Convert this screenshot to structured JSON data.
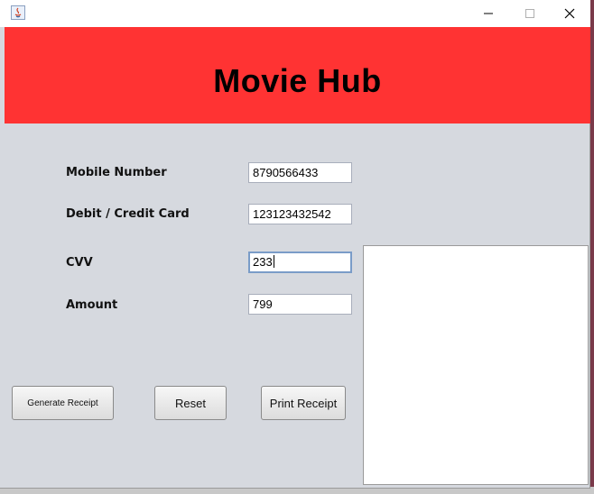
{
  "window": {
    "title": "",
    "icon": "java-icon",
    "controls": [
      "minimize-icon",
      "maximize-icon",
      "close-icon"
    ]
  },
  "header": {
    "title": "Movie Hub",
    "background_color": "#ff3333"
  },
  "form": {
    "mobile": {
      "label": "Mobile Number",
      "value": "8790566433"
    },
    "card": {
      "label": "Debit / Credit Card",
      "value": "123123432542"
    },
    "cvv": {
      "label": "CVV",
      "value": "233"
    },
    "amount": {
      "label": "Amount",
      "value": "799"
    }
  },
  "buttons": {
    "generate": "Generate Receipt",
    "reset": "Reset",
    "print": "Print Receipt"
  },
  "receipt": {
    "text": ""
  }
}
